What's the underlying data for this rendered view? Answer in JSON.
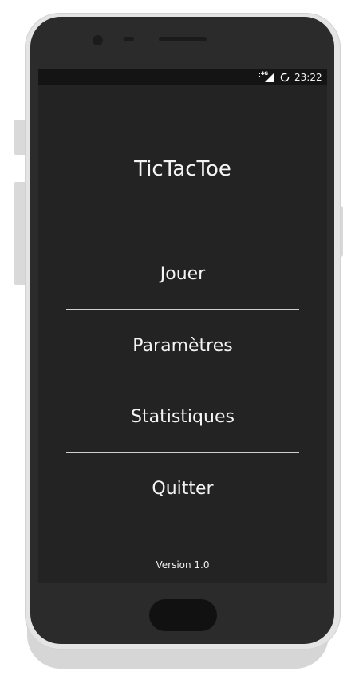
{
  "status_bar": {
    "network": "4G",
    "time": "23:22"
  },
  "app": {
    "title": "TicTacToe"
  },
  "menu": {
    "items": [
      {
        "label": "Jouer"
      },
      {
        "label": "Paramètres"
      },
      {
        "label": "Statistiques"
      },
      {
        "label": "Quitter"
      }
    ]
  },
  "footer": {
    "version": "Version 1.0"
  },
  "colors": {
    "screen_background": "#232323",
    "status_bar_background": "#141414",
    "text": "#f4f4f4",
    "divider": "#cfcfcf",
    "phone_body": "#2b2b2b",
    "phone_frame": "#e4e4e4"
  },
  "icons": {
    "network": "cellular-signal-icon",
    "battery": "battery-charging-icon"
  }
}
